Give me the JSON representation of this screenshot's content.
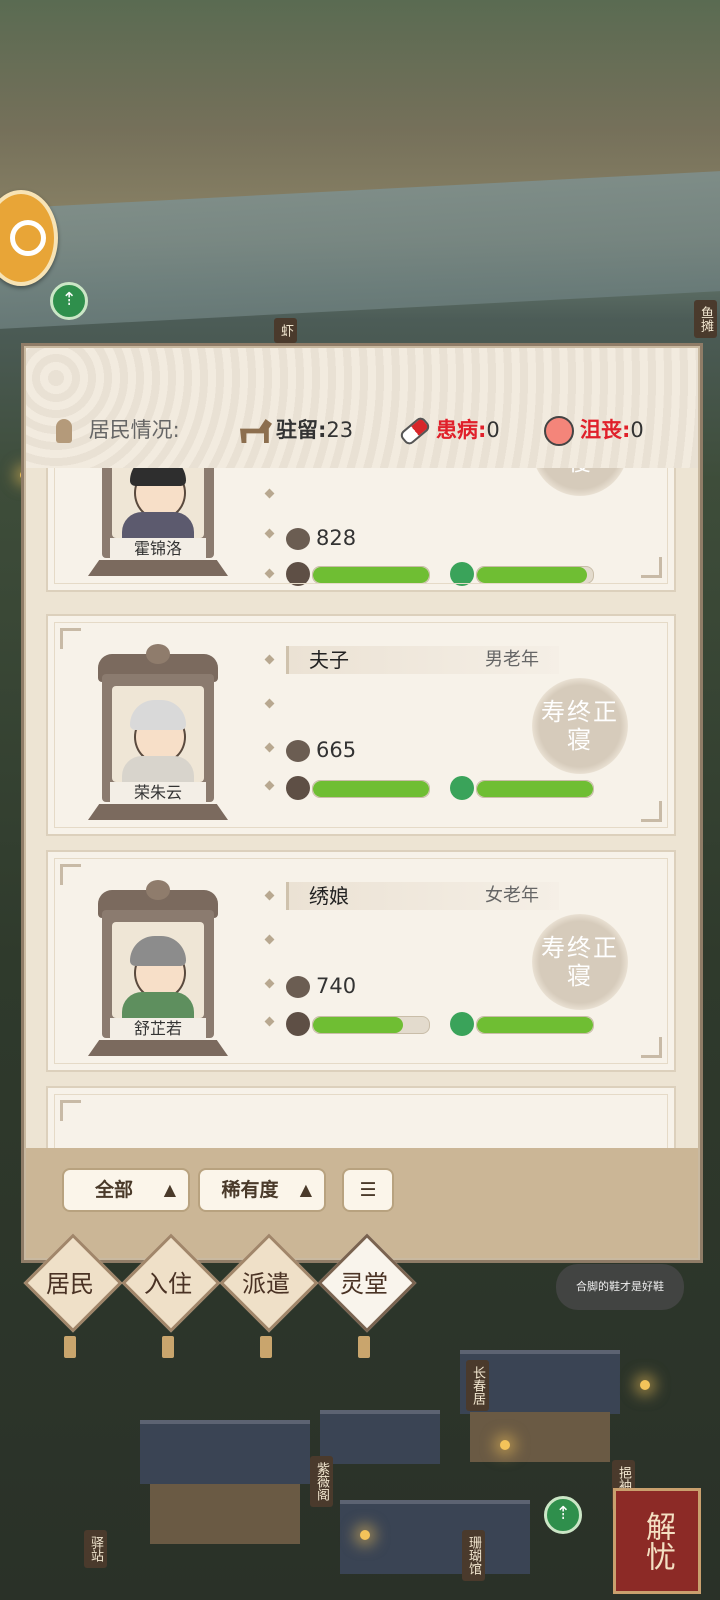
{
  "map": {
    "signs": [
      "虾",
      "鱼摊",
      "长春居",
      "紫薇阁",
      "驿站",
      "珊瑚馆",
      "挹袖亭"
    ],
    "speech_bubble": "合脚的鞋才是好鞋",
    "help_button": "解忧"
  },
  "panel": {
    "status": {
      "residents_label": "居民情况:",
      "stay_label": "驻留",
      "stay_value": "23",
      "sick_label": "患病",
      "sick_value": "0",
      "depressed_label": "沮丧",
      "depressed_value": "0"
    },
    "cards": [
      {
        "name": "霍锦洛",
        "occupation": "",
        "age_group": "",
        "wealth": "828",
        "health": 1.0,
        "mood": 0.95,
        "seal": "寿终正寝"
      },
      {
        "name": "荣朱云",
        "occupation": "夫子",
        "age_group": "男老年",
        "wealth": "665",
        "health": 1.0,
        "mood": 1.0,
        "seal": "寿终正寝"
      },
      {
        "name": "舒芷若",
        "occupation": "绣娘",
        "age_group": "女老年",
        "wealth": "740",
        "health": 0.78,
        "mood": 1.0,
        "seal": "寿终正寝"
      }
    ],
    "footer": {
      "filter_all": "全部",
      "filter_rarity": "稀有度",
      "sort_icon": "sort-icon"
    }
  },
  "tabs": [
    {
      "label": "居民"
    },
    {
      "label": "入住"
    },
    {
      "label": "派遣"
    },
    {
      "label": "灵堂",
      "active": true
    }
  ],
  "colors": {
    "bar_green": "#6fbe33",
    "alert_red": "#e0202a",
    "panel_bg": "#ede4d3"
  }
}
